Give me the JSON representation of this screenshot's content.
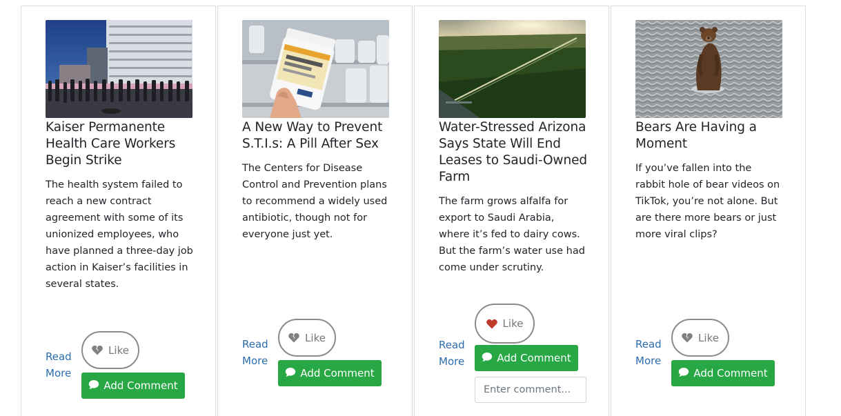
{
  "articles": [
    {
      "title": "Kaiser Permanente Health Care Workers Begin Strike",
      "description": "The health system failed to reach a new contract agreement with some of its unionized employees, who have planned a three-day job action in Kaiser’s facilities in several states.",
      "read_more": "Read More",
      "like_label": "Like",
      "liked": false,
      "comment_label": "Add Comment"
    },
    {
      "title": "A New Way to Prevent S.T.I.s: A Pill After Sex",
      "description": "The Centers for Disease Control and Prevention plans to recommend a widely used antibiotic, though not for everyone just yet.",
      "read_more": "Read More",
      "like_label": "Like",
      "liked": false,
      "comment_label": "Add Comment"
    },
    {
      "title": "Water-Stressed Arizona Says State Will End Leases to Saudi-Owned Farm",
      "description": "The farm grows alfalfa for export to Saudi Arabia, where it’s fed to dairy cows. But the farm’s water use had come under scrutiny.",
      "read_more": "Read More",
      "like_label": "Like",
      "liked": true,
      "comment_label": "Add Comment",
      "comment_placeholder": "Enter comment..."
    },
    {
      "title": "Bears Are Having a Moment",
      "description": "If you’ve fallen into the rabbit hole of bear videos on TikTok, you’re not alone. But are there more bears or just more viral clips?",
      "read_more": "Read More",
      "like_label": "Like",
      "liked": false,
      "comment_label": "Add Comment"
    }
  ],
  "colors": {
    "link": "#2b6cb0",
    "comment_button": "#28a745",
    "heart_liked": "#c0392b",
    "heart_unliked": "#808080"
  },
  "icons": {
    "like_unliked": "broken-heart-icon",
    "like_liked": "heart-icon",
    "comment": "comment-icon"
  }
}
